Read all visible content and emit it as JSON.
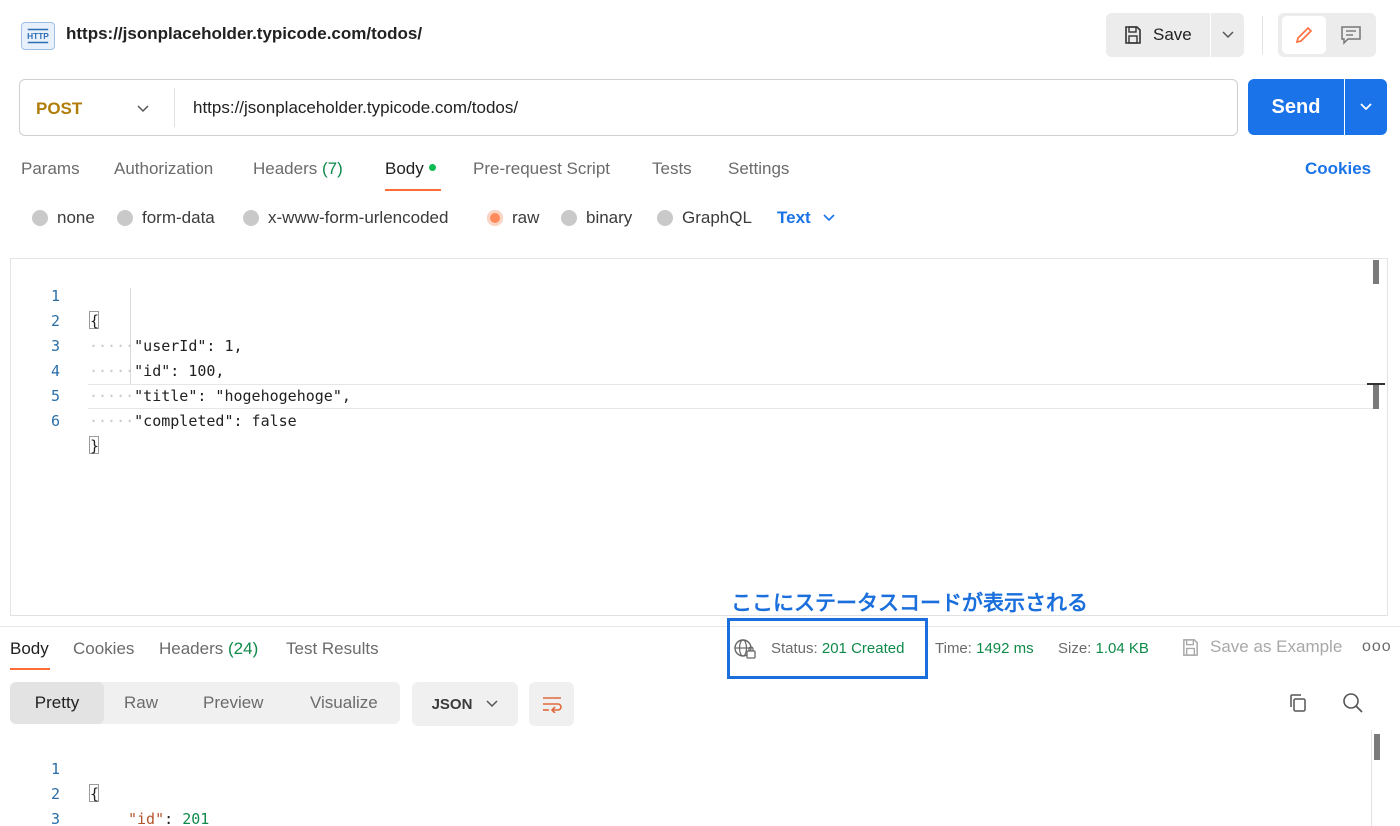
{
  "header": {
    "request_title": "https://jsonplaceholder.typicode.com/todos/",
    "save_label": "Save"
  },
  "request": {
    "method": "POST",
    "url": "https://jsonplaceholder.typicode.com/todos/",
    "send_label": "Send"
  },
  "request_tabs": [
    {
      "label": "Params"
    },
    {
      "label": "Authorization"
    },
    {
      "label": "Headers",
      "count": "(7)"
    },
    {
      "label": "Body"
    },
    {
      "label": "Pre-request Script"
    },
    {
      "label": "Tests"
    },
    {
      "label": "Settings"
    }
  ],
  "cookies_label": "Cookies",
  "body_types": [
    {
      "label": "none"
    },
    {
      "label": "form-data"
    },
    {
      "label": "x-www-form-urlencoded"
    },
    {
      "label": "raw"
    },
    {
      "label": "binary"
    },
    {
      "label": "GraphQL"
    }
  ],
  "raw_format": "Text",
  "request_body": {
    "line_numbers": [
      "1",
      "2",
      "3",
      "4",
      "5",
      "6"
    ],
    "open": "{",
    "close": "}",
    "lines": [
      "\"userId\": 1,",
      "\"id\": 100,",
      "\"title\": \"hogehogehoge\",",
      "\"completed\": false"
    ]
  },
  "annotation": "ここにステータスコードが表示される",
  "response_tabs": [
    {
      "label": "Body"
    },
    {
      "label": "Cookies"
    },
    {
      "label": "Headers",
      "count": "(24)"
    },
    {
      "label": "Test Results"
    }
  ],
  "response_meta": {
    "status_label": "Status:",
    "status_value": "201 Created",
    "time_label": "Time:",
    "time_value": "1492 ms",
    "size_label": "Size:",
    "size_value": "1.04 KB"
  },
  "save_as_example": "Save as Example",
  "more": "ooo",
  "view_options": [
    "Pretty",
    "Raw",
    "Preview",
    "Visualize"
  ],
  "response_format": "JSON",
  "response_body": {
    "line_numbers": [
      "1",
      "2",
      "3"
    ],
    "open": "{",
    "key": "\"id\"",
    "colon": ": ",
    "value": "201",
    "close": "}"
  },
  "colors": {
    "accent": "#1a73e8",
    "method": "#b07d0a",
    "active_tab": "#ff6c37",
    "status_ok": "#0f8a4a",
    "annotation": "#1a6fdc"
  }
}
